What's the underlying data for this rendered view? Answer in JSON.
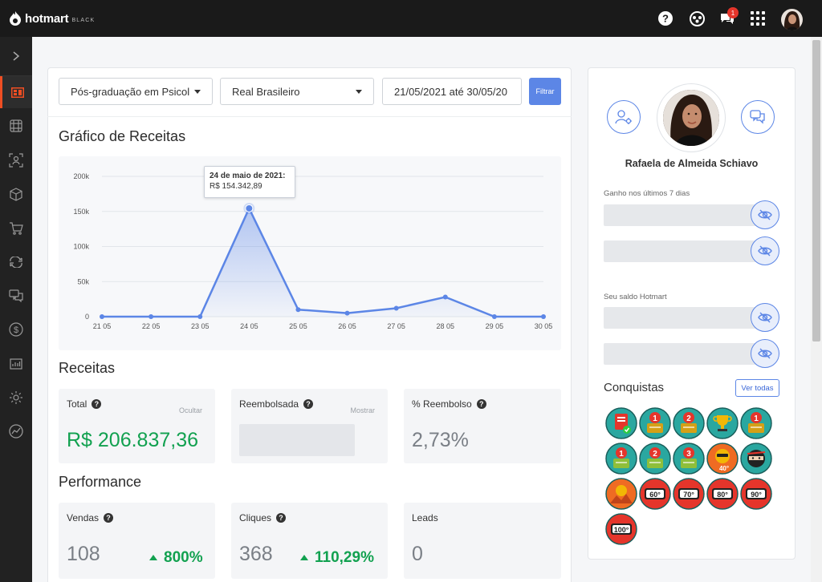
{
  "brand": {
    "name": "hotmart",
    "tier": "BLACK",
    "color": "#ef4e23"
  },
  "topbar": {
    "icons": [
      "help-icon",
      "community-icon",
      "chat-icon",
      "apps-grid-icon"
    ],
    "notification_count": "1"
  },
  "sidebar": {
    "items": [
      "expand-icon",
      "dashboard-icon",
      "products-grid-icon",
      "affiliates-icon",
      "box-icon",
      "cart-icon",
      "subscriptions-icon",
      "messages-icon",
      "money-icon",
      "reports-icon",
      "settings-icon",
      "analytics-icon"
    ]
  },
  "filters": {
    "product": "Pós-graduação em Psicol",
    "currency": "Real Brasileiro",
    "date_range": "21/05/2021 até 30/05/20",
    "filter_button": "Filtrar"
  },
  "revenue_chart": {
    "title": "Gráfico de Receitas",
    "tooltip_date": "24 de maio de 2021:",
    "tooltip_value": "R$ 154.342,89"
  },
  "chart_data": {
    "type": "area",
    "categories": [
      "21 05",
      "22 05",
      "23 05",
      "24 05",
      "25 05",
      "26 05",
      "27 05",
      "28 05",
      "29 05",
      "30 05"
    ],
    "series": [
      {
        "values": [
          0,
          0,
          0,
          154342.89,
          10000,
          5000,
          12000,
          28000,
          0,
          0
        ]
      }
    ],
    "y_ticks": [
      "0",
      "50k",
      "100k",
      "150k",
      "200k"
    ],
    "ylim": [
      0,
      200000
    ],
    "grid": true,
    "color": "#5c86e6"
  },
  "receitas": {
    "title": "Receitas",
    "total": {
      "label": "Total",
      "action": "Ocultar",
      "value": "R$ 206.837,36"
    },
    "reembolsada": {
      "label": "Reembolsada",
      "action": "Mostrar"
    },
    "perc_reembolso": {
      "label": "% Reembolso",
      "value": "2,73%"
    }
  },
  "performance": {
    "title": "Performance",
    "vendas": {
      "label": "Vendas",
      "value": "108",
      "delta": "800%"
    },
    "cliques": {
      "label": "Cliques",
      "value": "368",
      "delta": "110,29%"
    },
    "leads": {
      "label": "Leads",
      "value": "0"
    }
  },
  "profile": {
    "name": "Rafaela de Almeida Schiavo",
    "earned_label": "Ganho nos últimos 7 dias",
    "balance_label": "Seu saldo Hotmart"
  },
  "achievements": {
    "title": "Conquistas",
    "view_all": "Ver todas",
    "medals": [
      "certificate",
      "cart-1",
      "cart-2",
      "trophy",
      "rank-1",
      "robot-1",
      "robot-2",
      "robot-3",
      "sun-40",
      "ninja",
      "sun-desert",
      "speed-60",
      "speed-70",
      "speed-80",
      "speed-90",
      "speed-100"
    ],
    "medal_numbers": [
      "1",
      "2",
      "1",
      "1",
      "2",
      "3",
      "40°",
      "60°",
      "70°",
      "80°",
      "90°",
      "100°"
    ]
  }
}
